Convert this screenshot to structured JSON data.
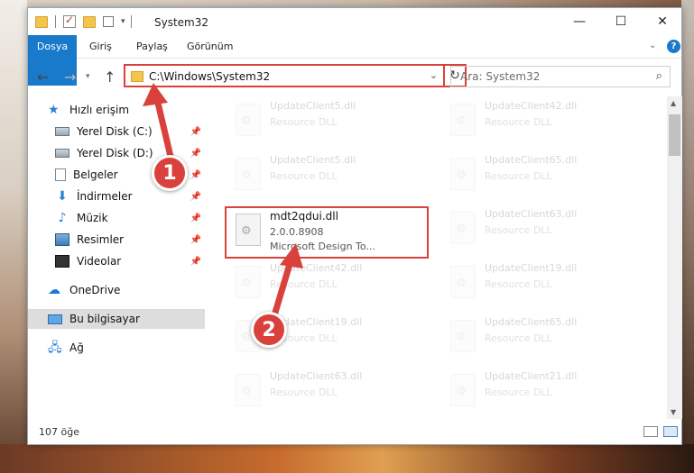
{
  "window": {
    "title": "System32",
    "controls": {
      "minimize": "—",
      "maximize": "☐",
      "close": "✕"
    }
  },
  "ribbon": {
    "tabs": [
      "Dosya",
      "Giriş",
      "Paylaş",
      "Görünüm"
    ]
  },
  "address": {
    "path": "C:\\Windows\\System32",
    "search_placeholder": "Ara: System32"
  },
  "sidebar": {
    "items": [
      {
        "label": "Hızlı erişim",
        "icon": "quick-access-star-icon"
      },
      {
        "label": "Yerel Disk (C:)",
        "icon": "drive-icon",
        "pinned": true
      },
      {
        "label": "Yerel Disk (D:)",
        "icon": "drive-icon",
        "pinned": true
      },
      {
        "label": "Belgeler",
        "icon": "documents-icon",
        "pinned": true
      },
      {
        "label": "İndirmeler",
        "icon": "downloads-icon",
        "pinned": true
      },
      {
        "label": "Müzik",
        "icon": "music-icon",
        "pinned": true
      },
      {
        "label": "Resimler",
        "icon": "pictures-icon",
        "pinned": true
      },
      {
        "label": "Videolar",
        "icon": "videos-icon",
        "pinned": true
      },
      {
        "label": "OneDrive",
        "icon": "onedrive-icon"
      },
      {
        "label": "Bu bilgisayar",
        "icon": "this-pc-icon",
        "selected": true
      },
      {
        "label": "Ağ",
        "icon": "network-icon"
      }
    ]
  },
  "files": [
    {
      "name": "UpdateClient5.dll",
      "type": "Resource DLL"
    },
    {
      "name": "UpdateClient42.dll",
      "type": "Resource DLL"
    },
    {
      "name": "UpdateClient5.dll",
      "type": "Resource DLL"
    },
    {
      "name": "UpdateClient65.dll",
      "type": "Resource DLL"
    },
    {
      "name": "mdt2qdui.dll",
      "version": "2.0.0.8908",
      "description": "Microsoft Design To..."
    },
    {
      "name": "UpdateClient63.dll",
      "type": "Resource DLL"
    },
    {
      "name": "UpdateClient42.dll",
      "type": "Resource DLL"
    },
    {
      "name": "UpdateClient19.dll",
      "type": "Resource DLL"
    },
    {
      "name": "UpdateClient19.dll",
      "type": "Resource DLL"
    },
    {
      "name": "UpdateClient65.dll",
      "type": "Resource DLL"
    },
    {
      "name": "UpdateClient63.dll",
      "type": "Resource DLL"
    },
    {
      "name": "UpdateClient21.dll",
      "type": "Resource DLL"
    }
  ],
  "status": {
    "item_count": "107 öğe"
  },
  "annotations": {
    "step1": "1",
    "step2": "2"
  },
  "colors": {
    "accent": "#1979ca",
    "highlight": "#d9423c"
  }
}
